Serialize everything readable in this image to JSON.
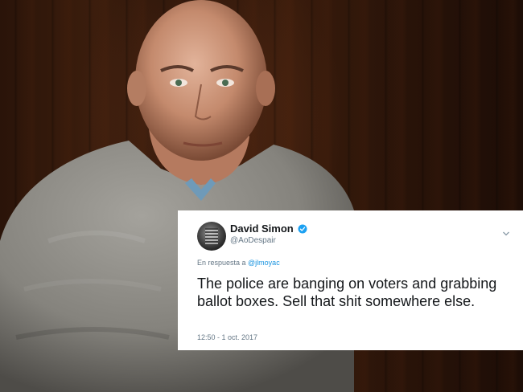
{
  "tweet": {
    "display_name": "David Simon",
    "handle": "@AoDespair",
    "reply_prefix": "En respuesta a ",
    "reply_mention": "@jlmoyac",
    "text": "The police are banging on voters and grabbing ballot boxes. Sell that shit somewhere else.",
    "timestamp": "12:50 - 1 oct. 2017",
    "verified_color": "#1da1f2",
    "icons": [
      "verified-badge-icon",
      "chevron-down-icon"
    ]
  }
}
